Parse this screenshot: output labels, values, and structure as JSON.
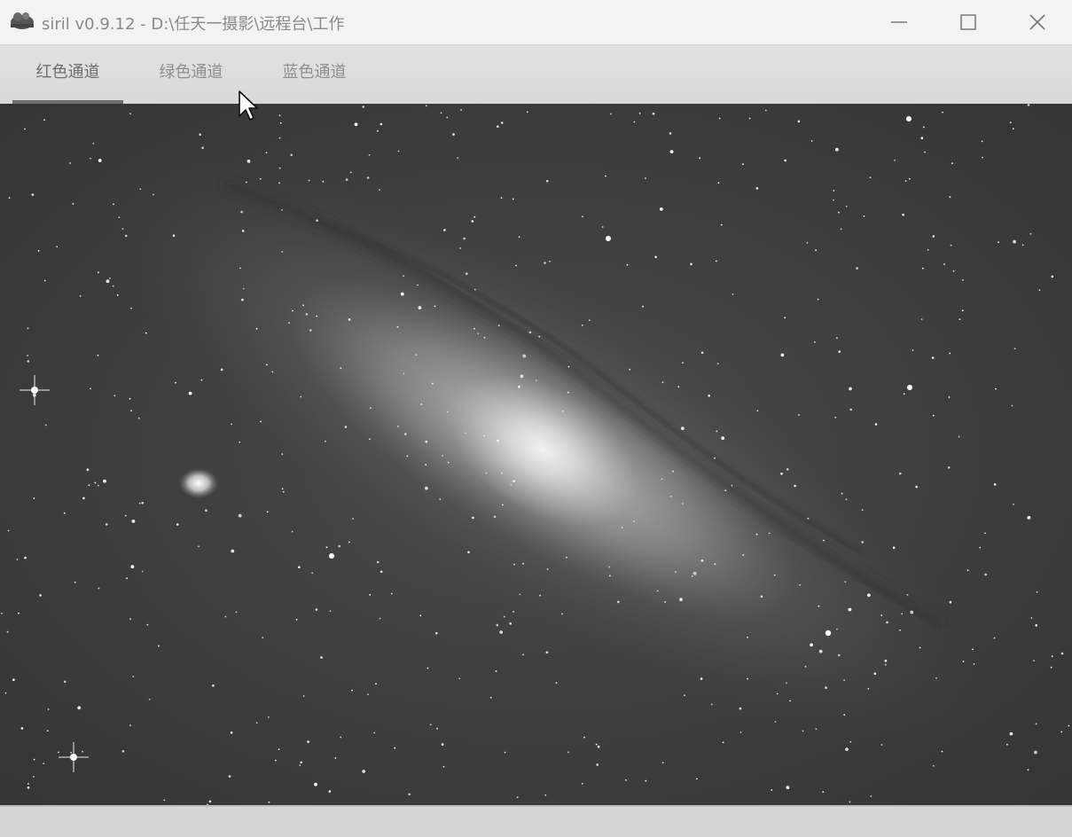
{
  "window": {
    "title": "siril v0.9.12 - D:\\任天一摄影\\远程台\\工作",
    "app_icon": "siril-app-icon",
    "controls": [
      "minimize-icon",
      "maximize-icon",
      "close-icon"
    ]
  },
  "tabs": [
    {
      "label": "红色通道",
      "active": true
    },
    {
      "label": "绿色通道",
      "active": false
    },
    {
      "label": "蓝色通道",
      "active": false
    }
  ],
  "viewer": {
    "content": "grayscale-astro-image"
  },
  "colors": {
    "titlebar_bg": "#f3f3f3",
    "tabbar_bg": "#dcdcdc",
    "active_tab_underline": "#6e6e6e",
    "sky_bg": "#3c3c3c"
  }
}
